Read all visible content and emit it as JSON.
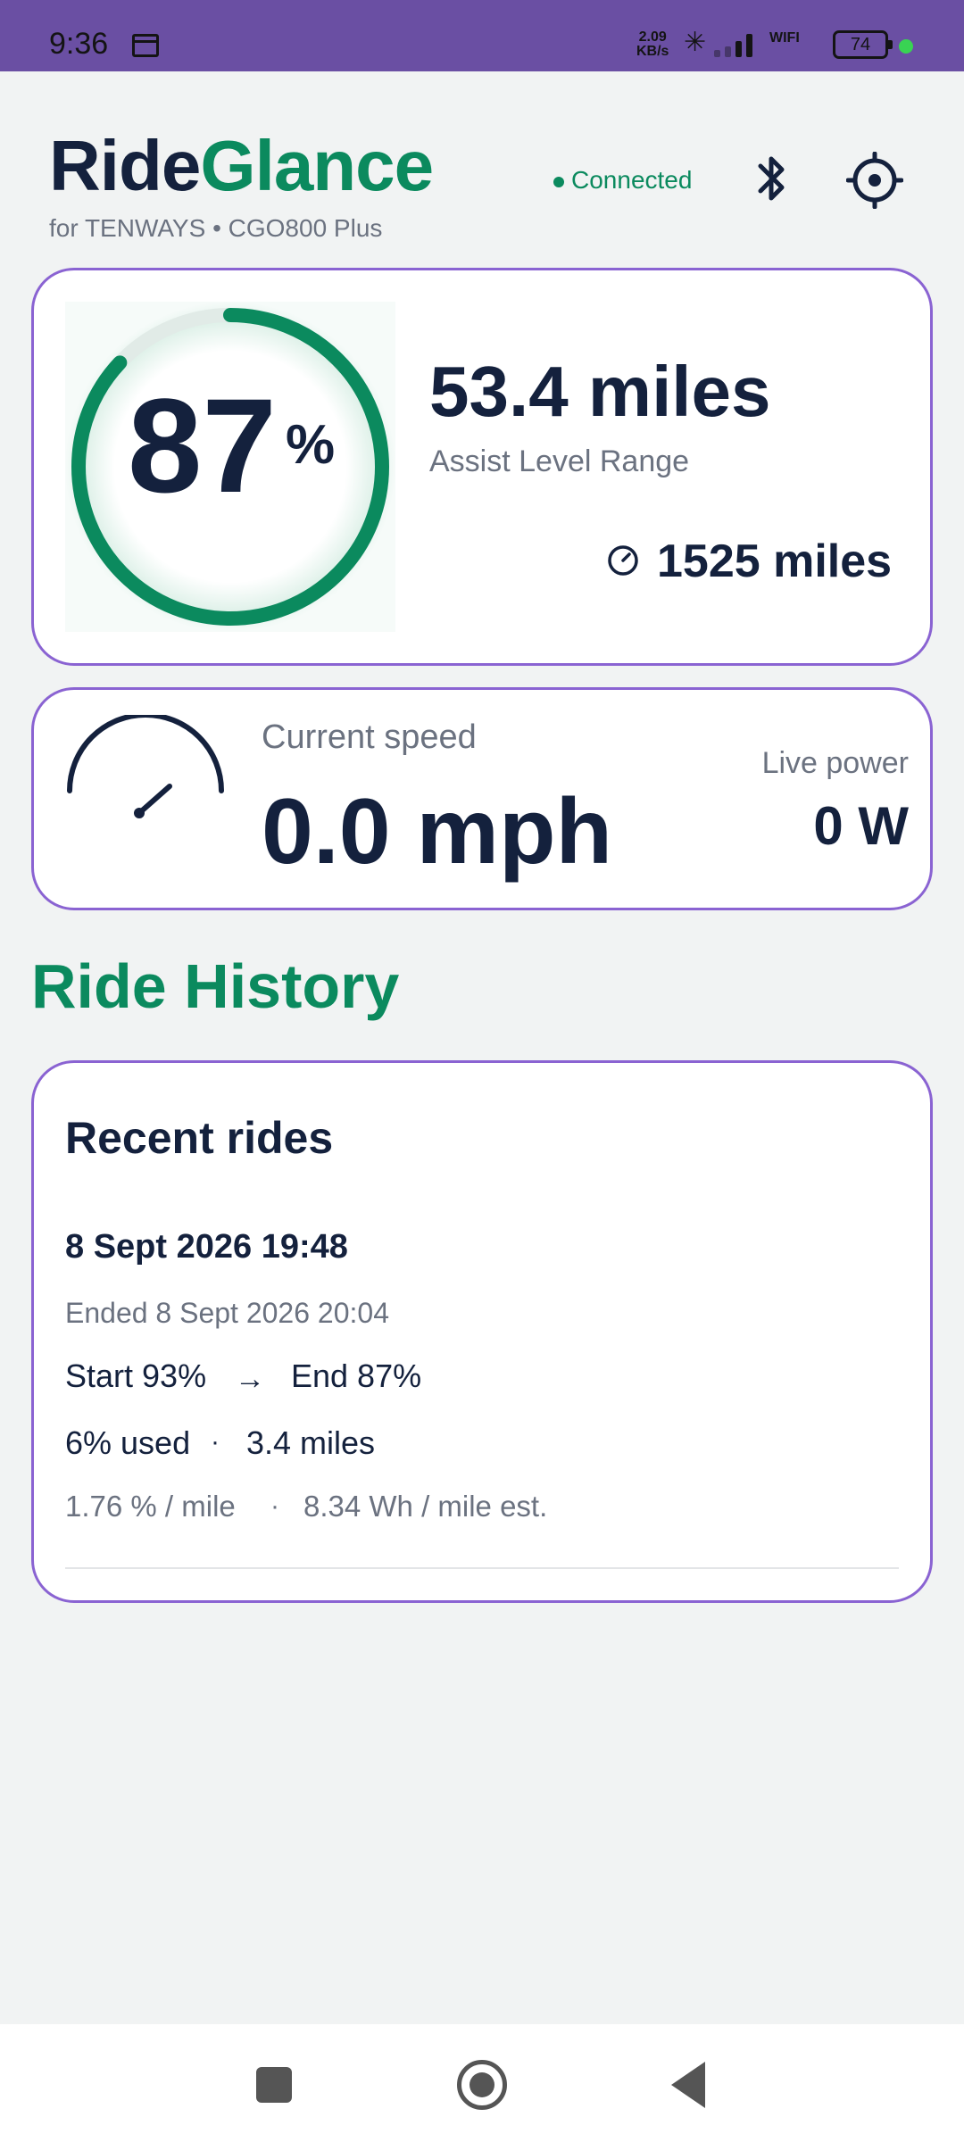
{
  "status_bar": {
    "time": "9:36",
    "net_speed_value": "2.09",
    "net_speed_unit": "KB/s",
    "wifi_label": "WIFI",
    "battery_level": "74"
  },
  "header": {
    "brand_part1": "Ride",
    "brand_part2": "Glance",
    "subtitle": "for TENWAYS • CGO800 Plus",
    "connection_status": "Connected"
  },
  "battery_card": {
    "percent": "87",
    "percent_symbol": "%",
    "percent_fraction": 0.87,
    "range_value": "53.4 miles",
    "range_label": "Assist Level Range",
    "odometer": "1525 miles"
  },
  "speed_card": {
    "speed_label": "Current speed",
    "speed_value": "0.0 mph",
    "power_label": "Live power",
    "power_value": "0 W"
  },
  "history": {
    "section_title": "Ride History",
    "card_title": "Recent rides",
    "rides": [
      {
        "date": "8 Sept 2026 19:48",
        "ended": "Ended 8 Sept 2026 20:04",
        "start": "Start 93%",
        "arrow": "→",
        "end": "End 87%",
        "used": "6% used",
        "separator": "·",
        "miles": "3.4 miles",
        "rate": "1.76 % / mile",
        "wh": "8.34 Wh / mile est."
      }
    ]
  },
  "colors": {
    "accent_green": "#0b8a5e",
    "card_border": "#8a63d2",
    "status_bar": "#6a4fa3",
    "text_dark": "#14213d",
    "text_muted": "#6b7280"
  },
  "icons": {
    "bluetooth": "bluetooth-icon",
    "settings": "settings-icon",
    "odometer": "odometer-icon",
    "speed_gauge": "speedometer-icon"
  }
}
